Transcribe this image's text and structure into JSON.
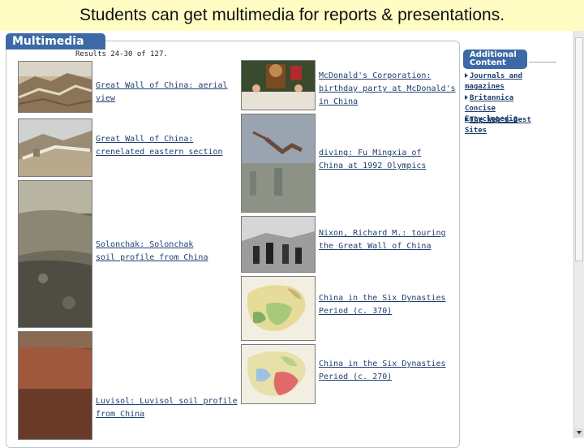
{
  "slide": {
    "title": "Students can get multimedia for reports & presentations."
  },
  "panel": {
    "tab_label": "Multimedia",
    "results_text": "Results 24-30 of 127."
  },
  "items": [
    {
      "caption": "Great Wall of China: aerial view"
    },
    {
      "caption": "Great Wall of China: crenelated eastern section"
    },
    {
      "caption": "Solonchak: Solonchak soil profile from China"
    },
    {
      "caption": "Luvisol: Luvisol soil profile from China"
    },
    {
      "caption": "McDonald's Corporation: birthday party at McDonald's in China"
    },
    {
      "caption": "diving: Fu Mingxia of China at 1992 Olympics"
    },
    {
      "caption": "Nixon, Richard M.: touring the Great Wall of China"
    },
    {
      "caption": "China in the Six Dynasties Period (c. 370)"
    },
    {
      "caption": "China in the Six Dynasties Period (c. 270)"
    }
  ],
  "sidebar": {
    "header": "Additional Content",
    "links": [
      {
        "label": "Journals and magazines"
      },
      {
        "label": "Britannica Concise Encyclopedia"
      },
      {
        "label": "The Web's Best Sites"
      }
    ]
  }
}
